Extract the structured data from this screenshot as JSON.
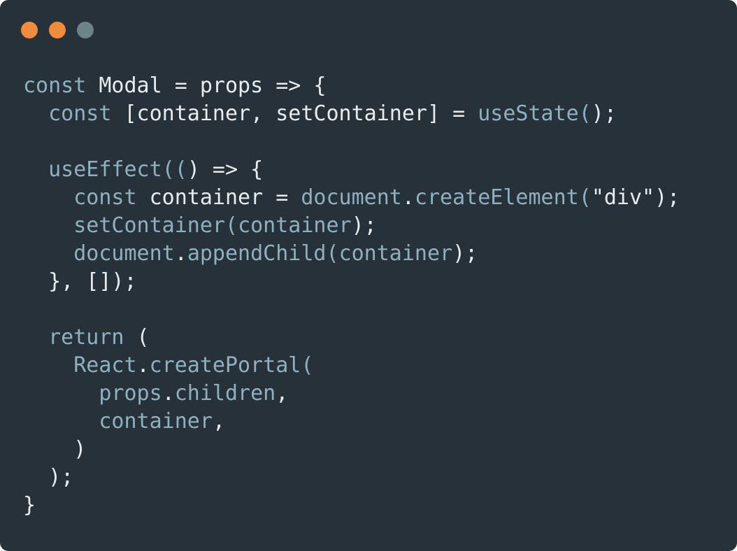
{
  "colors": {
    "background": "#263139",
    "keyword": "#8fb0bf",
    "plain": "#e8ecee",
    "window_controls": [
      "#f28b3b",
      "#f28b3b",
      "#6c8387"
    ]
  },
  "window_controls": [
    "close-dot",
    "minimize-dot",
    "zoom-dot"
  ],
  "code_lines": [
    [
      {
        "t": "const",
        "c": "keyword"
      },
      {
        "t": " Modal = props => {",
        "c": "plain"
      }
    ],
    [
      {
        "t": "  ",
        "c": "plain"
      },
      {
        "t": "const",
        "c": "keyword"
      },
      {
        "t": " [container, setContainer] = ",
        "c": "plain"
      },
      {
        "t": "useState",
        "c": "keyword"
      },
      {
        "t": "(",
        "c": "keyword"
      },
      {
        "t": ");",
        "c": "plain"
      }
    ],
    [],
    [
      {
        "t": "  ",
        "c": "plain"
      },
      {
        "t": "useEffect",
        "c": "keyword"
      },
      {
        "t": "((",
        "c": "keyword"
      },
      {
        "t": ") => {",
        "c": "plain"
      }
    ],
    [
      {
        "t": "    ",
        "c": "plain"
      },
      {
        "t": "const",
        "c": "keyword"
      },
      {
        "t": " container = ",
        "c": "plain"
      },
      {
        "t": "document",
        "c": "keyword"
      },
      {
        "t": ".",
        "c": "plain"
      },
      {
        "t": "createElement",
        "c": "keyword"
      },
      {
        "t": "(",
        "c": "keyword"
      },
      {
        "t": "\"div\");",
        "c": "plain"
      }
    ],
    [
      {
        "t": "    ",
        "c": "plain"
      },
      {
        "t": "setContainer",
        "c": "keyword"
      },
      {
        "t": "(",
        "c": "keyword"
      },
      {
        "t": "container",
        "c": "keyword"
      },
      {
        "t": ");",
        "c": "plain"
      }
    ],
    [
      {
        "t": "    ",
        "c": "plain"
      },
      {
        "t": "document",
        "c": "keyword"
      },
      {
        "t": ".",
        "c": "plain"
      },
      {
        "t": "appendChild",
        "c": "keyword"
      },
      {
        "t": "(",
        "c": "keyword"
      },
      {
        "t": "container",
        "c": "keyword"
      },
      {
        "t": ");",
        "c": "plain"
      }
    ],
    [
      {
        "t": "  }, []);",
        "c": "plain"
      }
    ],
    [],
    [
      {
        "t": "  ",
        "c": "plain"
      },
      {
        "t": "return",
        "c": "keyword"
      },
      {
        "t": " (",
        "c": "plain"
      }
    ],
    [
      {
        "t": "    ",
        "c": "plain"
      },
      {
        "t": "React",
        "c": "keyword"
      },
      {
        "t": ".",
        "c": "plain"
      },
      {
        "t": "createPortal",
        "c": "keyword"
      },
      {
        "t": "(",
        "c": "keyword"
      }
    ],
    [
      {
        "t": "      ",
        "c": "plain"
      },
      {
        "t": "props",
        "c": "keyword"
      },
      {
        "t": ".",
        "c": "plain"
      },
      {
        "t": "children",
        "c": "keyword"
      },
      {
        "t": ",",
        "c": "plain"
      }
    ],
    [
      {
        "t": "      ",
        "c": "plain"
      },
      {
        "t": "container",
        "c": "keyword"
      },
      {
        "t": ",",
        "c": "plain"
      }
    ],
    [
      {
        "t": "    )",
        "c": "plain"
      }
    ],
    [
      {
        "t": "  );",
        "c": "plain"
      }
    ],
    [
      {
        "t": "}",
        "c": "plain"
      }
    ]
  ]
}
